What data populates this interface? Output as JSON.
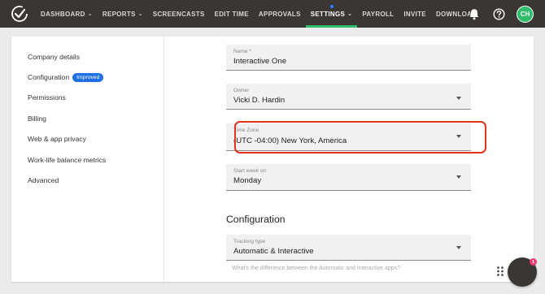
{
  "nav": {
    "items": [
      {
        "label": "DASHBOARD",
        "has_dropdown": true,
        "active": false
      },
      {
        "label": "REPORTS",
        "has_dropdown": true,
        "active": false
      },
      {
        "label": "SCREENCASTS",
        "has_dropdown": false,
        "active": false
      },
      {
        "label": "EDIT TIME",
        "has_dropdown": false,
        "active": false
      },
      {
        "label": "APPROVALS",
        "has_dropdown": false,
        "active": false
      },
      {
        "label": "SETTINGS",
        "has_dropdown": true,
        "active": true
      },
      {
        "label": "PAYROLL",
        "has_dropdown": false,
        "active": false
      },
      {
        "label": "INVITE",
        "has_dropdown": false,
        "active": false
      },
      {
        "label": "DOWNLOAD",
        "has_dropdown": false,
        "active": false
      }
    ],
    "avatar_initials": "CH",
    "active_color": "#2fbd6a"
  },
  "sidebar": {
    "items": [
      {
        "label": "Company details"
      },
      {
        "label": "Configuration",
        "badge": "Improved"
      },
      {
        "label": "Permissions"
      },
      {
        "label": "Billing"
      },
      {
        "label": "Web & app privacy"
      },
      {
        "label": "Work-life balance metrics"
      },
      {
        "label": "Advanced"
      }
    ]
  },
  "form": {
    "name": {
      "label": "Name *",
      "value": "Interactive One"
    },
    "owner": {
      "label": "Owner",
      "value": "Vicki D. Hardin"
    },
    "timezone": {
      "label": "Time Zone",
      "value": "(UTC -04:00) New York, America"
    },
    "start_week": {
      "label": "Start week on",
      "value": "Monday"
    }
  },
  "configuration": {
    "title": "Configuration",
    "tracking_type": {
      "label": "Tracking type",
      "value": "Automatic & Interactive"
    },
    "help_text": "What's the difference between the Automatic and Interactive apps?"
  },
  "chat": {
    "badge_count": "1"
  },
  "colors": {
    "highlight": "#e0321c",
    "badge": "#1f6fe5",
    "topbar": "#3a3633"
  }
}
